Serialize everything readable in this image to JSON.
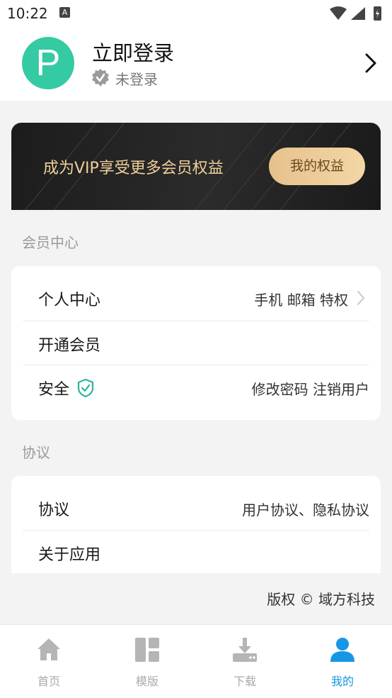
{
  "status_bar": {
    "time": "10:22",
    "notification_glyph": "A"
  },
  "header": {
    "avatar_letter": "P",
    "title": "立即登录",
    "status": "未登录"
  },
  "vip": {
    "text": "成为VIP享受更多会员权益",
    "button": "我的权益"
  },
  "member_section": {
    "title": "会员中心",
    "rows": [
      {
        "label": "个人中心",
        "value": "手机 邮箱 特权"
      },
      {
        "label": "开通会员",
        "value": ""
      },
      {
        "label": "安全",
        "value": "修改密码  注销用户"
      }
    ]
  },
  "agreement_section": {
    "title": "协议",
    "rows": [
      {
        "label": "协议",
        "value": "用户协议、隐私协议"
      },
      {
        "label": "关于应用",
        "value": ""
      }
    ]
  },
  "copyright": "版权 © 域方科技",
  "nav": {
    "items": [
      {
        "label": "首页",
        "icon": "home-icon"
      },
      {
        "label": "模版",
        "icon": "template-icon"
      },
      {
        "label": "下载",
        "icon": "download-icon"
      },
      {
        "label": "我的",
        "icon": "user-icon",
        "active": true
      }
    ]
  },
  "colors": {
    "accent": "#1796e6",
    "avatar": "#35cba2",
    "vip_gold": "#f0cf9a",
    "shield": "#2bb59a"
  }
}
